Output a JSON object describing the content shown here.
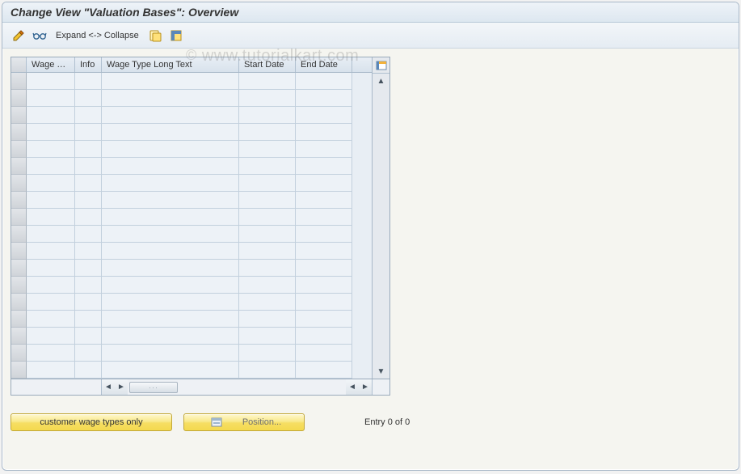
{
  "window": {
    "title": "Change View \"Valuation Bases\": Overview"
  },
  "toolbar": {
    "expand_collapse_label": "Expand <-> Collapse"
  },
  "table": {
    "columns": {
      "wage_type": "Wage Ty...",
      "info": "Info",
      "long_text": "Wage Type Long Text",
      "start_date": "Start Date",
      "end_date": "End Date"
    },
    "row_count": 18
  },
  "buttons": {
    "customer_wage_types": "customer wage types only",
    "position": "Position..."
  },
  "status": {
    "entry_text": "Entry 0 of 0"
  },
  "watermark": {
    "text": "www.tutorialkart.com",
    "prefix": "©"
  }
}
